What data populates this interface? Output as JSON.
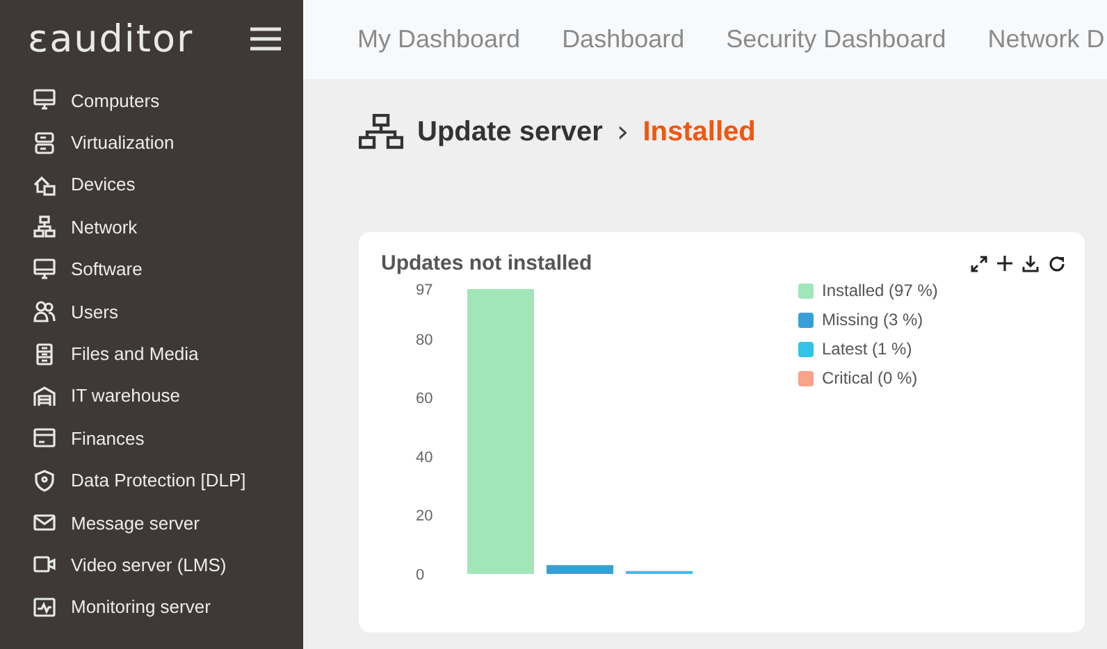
{
  "sidebar": {
    "logo": "ɛauditor",
    "items": [
      {
        "label": "Computers"
      },
      {
        "label": "Virtualization"
      },
      {
        "label": "Devices"
      },
      {
        "label": "Network"
      },
      {
        "label": "Software"
      },
      {
        "label": "Users"
      },
      {
        "label": "Files and Media"
      },
      {
        "label": "IT warehouse"
      },
      {
        "label": "Finances"
      },
      {
        "label": "Data Protection [DLP]"
      },
      {
        "label": "Message server"
      },
      {
        "label": "Video server (LMS)"
      },
      {
        "label": "Monitoring server"
      }
    ]
  },
  "tabs": [
    {
      "label": "My Dashboard"
    },
    {
      "label": "Dashboard"
    },
    {
      "label": "Security Dashboard"
    },
    {
      "label": "Network D"
    }
  ],
  "breadcrumb": {
    "parent": "Update server",
    "separator": "›",
    "current": "Installed"
  },
  "card": {
    "title": "Updates not installed",
    "chart_data": {
      "type": "bar",
      "ylim": [
        0,
        97
      ],
      "yticks": [
        {
          "value": 0,
          "label": "0"
        },
        {
          "value": 20,
          "label": "20"
        },
        {
          "value": 40,
          "label": "40"
        },
        {
          "value": 60,
          "label": "60"
        },
        {
          "value": 80,
          "label": "80"
        },
        {
          "value": 97,
          "label": "97"
        }
      ],
      "series": [
        {
          "name": "Installed (97 %)",
          "color": "#a1e6b8",
          "values": [
            97
          ]
        },
        {
          "name": "Missing (3 %)",
          "color": "#379fd7",
          "values": [
            3
          ]
        },
        {
          "name": "Latest (1 %)",
          "color": "#33c3ea",
          "values": [
            1
          ]
        },
        {
          "name": "Critical (0 %)",
          "color": "#fba28a",
          "values": [
            0
          ]
        }
      ]
    }
  }
}
